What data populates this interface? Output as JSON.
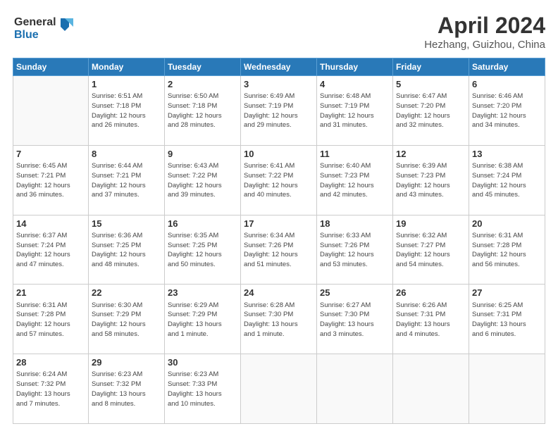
{
  "header": {
    "logo_line1": "General",
    "logo_line2": "Blue",
    "main_title": "April 2024",
    "subtitle": "Hezhang, Guizhou, China"
  },
  "weekdays": [
    "Sunday",
    "Monday",
    "Tuesday",
    "Wednesday",
    "Thursday",
    "Friday",
    "Saturday"
  ],
  "weeks": [
    [
      {
        "day": "",
        "info": ""
      },
      {
        "day": "1",
        "info": "Sunrise: 6:51 AM\nSunset: 7:18 PM\nDaylight: 12 hours\nand 26 minutes."
      },
      {
        "day": "2",
        "info": "Sunrise: 6:50 AM\nSunset: 7:18 PM\nDaylight: 12 hours\nand 28 minutes."
      },
      {
        "day": "3",
        "info": "Sunrise: 6:49 AM\nSunset: 7:19 PM\nDaylight: 12 hours\nand 29 minutes."
      },
      {
        "day": "4",
        "info": "Sunrise: 6:48 AM\nSunset: 7:19 PM\nDaylight: 12 hours\nand 31 minutes."
      },
      {
        "day": "5",
        "info": "Sunrise: 6:47 AM\nSunset: 7:20 PM\nDaylight: 12 hours\nand 32 minutes."
      },
      {
        "day": "6",
        "info": "Sunrise: 6:46 AM\nSunset: 7:20 PM\nDaylight: 12 hours\nand 34 minutes."
      }
    ],
    [
      {
        "day": "7",
        "info": "Sunrise: 6:45 AM\nSunset: 7:21 PM\nDaylight: 12 hours\nand 36 minutes."
      },
      {
        "day": "8",
        "info": "Sunrise: 6:44 AM\nSunset: 7:21 PM\nDaylight: 12 hours\nand 37 minutes."
      },
      {
        "day": "9",
        "info": "Sunrise: 6:43 AM\nSunset: 7:22 PM\nDaylight: 12 hours\nand 39 minutes."
      },
      {
        "day": "10",
        "info": "Sunrise: 6:41 AM\nSunset: 7:22 PM\nDaylight: 12 hours\nand 40 minutes."
      },
      {
        "day": "11",
        "info": "Sunrise: 6:40 AM\nSunset: 7:23 PM\nDaylight: 12 hours\nand 42 minutes."
      },
      {
        "day": "12",
        "info": "Sunrise: 6:39 AM\nSunset: 7:23 PM\nDaylight: 12 hours\nand 43 minutes."
      },
      {
        "day": "13",
        "info": "Sunrise: 6:38 AM\nSunset: 7:24 PM\nDaylight: 12 hours\nand 45 minutes."
      }
    ],
    [
      {
        "day": "14",
        "info": "Sunrise: 6:37 AM\nSunset: 7:24 PM\nDaylight: 12 hours\nand 47 minutes."
      },
      {
        "day": "15",
        "info": "Sunrise: 6:36 AM\nSunset: 7:25 PM\nDaylight: 12 hours\nand 48 minutes."
      },
      {
        "day": "16",
        "info": "Sunrise: 6:35 AM\nSunset: 7:25 PM\nDaylight: 12 hours\nand 50 minutes."
      },
      {
        "day": "17",
        "info": "Sunrise: 6:34 AM\nSunset: 7:26 PM\nDaylight: 12 hours\nand 51 minutes."
      },
      {
        "day": "18",
        "info": "Sunrise: 6:33 AM\nSunset: 7:26 PM\nDaylight: 12 hours\nand 53 minutes."
      },
      {
        "day": "19",
        "info": "Sunrise: 6:32 AM\nSunset: 7:27 PM\nDaylight: 12 hours\nand 54 minutes."
      },
      {
        "day": "20",
        "info": "Sunrise: 6:31 AM\nSunset: 7:28 PM\nDaylight: 12 hours\nand 56 minutes."
      }
    ],
    [
      {
        "day": "21",
        "info": "Sunrise: 6:31 AM\nSunset: 7:28 PM\nDaylight: 12 hours\nand 57 minutes."
      },
      {
        "day": "22",
        "info": "Sunrise: 6:30 AM\nSunset: 7:29 PM\nDaylight: 12 hours\nand 58 minutes."
      },
      {
        "day": "23",
        "info": "Sunrise: 6:29 AM\nSunset: 7:29 PM\nDaylight: 13 hours\nand 1 minute."
      },
      {
        "day": "24",
        "info": "Sunrise: 6:28 AM\nSunset: 7:30 PM\nDaylight: 13 hours\nand 1 minute."
      },
      {
        "day": "25",
        "info": "Sunrise: 6:27 AM\nSunset: 7:30 PM\nDaylight: 13 hours\nand 3 minutes."
      },
      {
        "day": "26",
        "info": "Sunrise: 6:26 AM\nSunset: 7:31 PM\nDaylight: 13 hours\nand 4 minutes."
      },
      {
        "day": "27",
        "info": "Sunrise: 6:25 AM\nSunset: 7:31 PM\nDaylight: 13 hours\nand 6 minutes."
      }
    ],
    [
      {
        "day": "28",
        "info": "Sunrise: 6:24 AM\nSunset: 7:32 PM\nDaylight: 13 hours\nand 7 minutes."
      },
      {
        "day": "29",
        "info": "Sunrise: 6:23 AM\nSunset: 7:32 PM\nDaylight: 13 hours\nand 8 minutes."
      },
      {
        "day": "30",
        "info": "Sunrise: 6:23 AM\nSunset: 7:33 PM\nDaylight: 13 hours\nand 10 minutes."
      },
      {
        "day": "",
        "info": ""
      },
      {
        "day": "",
        "info": ""
      },
      {
        "day": "",
        "info": ""
      },
      {
        "day": "",
        "info": ""
      }
    ]
  ]
}
